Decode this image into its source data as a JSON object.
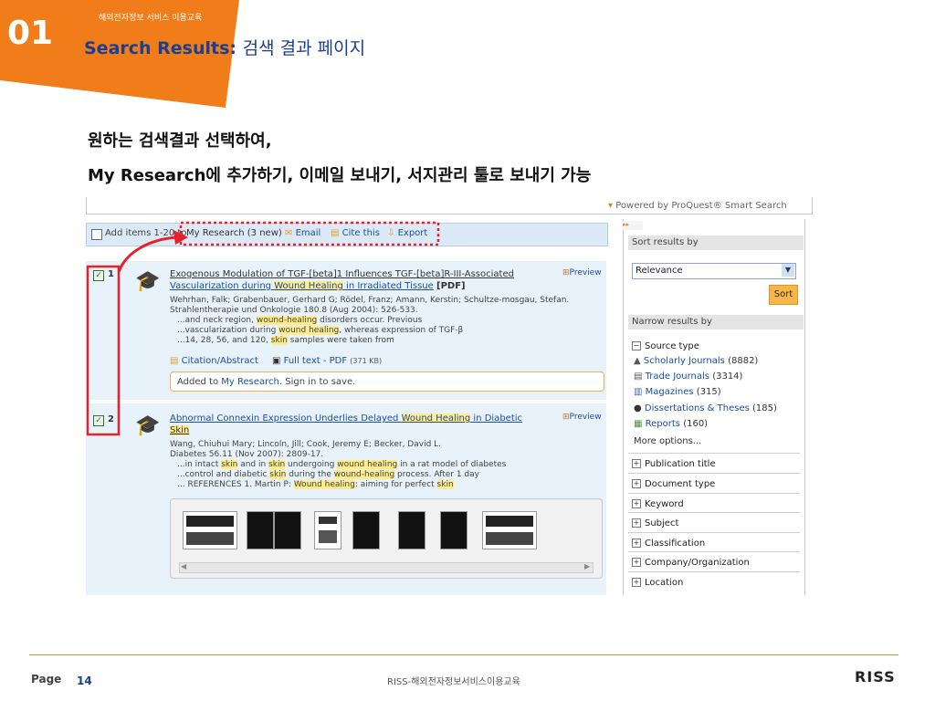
{
  "header": {
    "slide_number": "01",
    "caption": "해외전자정보 서비스 이용교육",
    "title_en": "Search Results:",
    "title_ko": "검색 결과 페이지"
  },
  "body_lines": [
    "원하는 검색결과 선택하여,",
    "My Research에 추가하기, 이메일 보내기, 서지관리 툴로 보내기 가능"
  ],
  "screenshot": {
    "powered_by": "Powered by ProQuest® Smart Search",
    "toolbar": {
      "add_items": "Add items 1-20 to",
      "my_research": "My Research (3 new)",
      "email": "Email",
      "cite": "Cite this",
      "export": "Export"
    },
    "results": [
      {
        "number": "1",
        "title_line1": "Exogenous Modulation of TGF-[beta]1 Influences TGF-[beta]R-III-Associated",
        "title_line2_pre": "Vascularization during ",
        "title_line2_hl": "Wound Healing",
        "title_line2_post": " in Irradiated Tissue",
        "format": "[PDF]",
        "preview": "Preview",
        "authors": "Wehrhan, Falk; Grabenbauer, Gerhard G; Rödel, Franz; Amann, Kerstin; Schultze-mosgau, Stefan.",
        "source": "Strahlentherapie und Onkologie 180.8 (Aug 2004): 526-533.",
        "snippets": [
          [
            "...and neck region, ",
            "wound-healing",
            " disorders occur. Previous"
          ],
          [
            "...vascularization during ",
            "wound healing",
            ", whereas expression of TGF-β"
          ],
          [
            "...14, 28, 56, and 120, ",
            "skin",
            " samples were taken from"
          ]
        ],
        "citation_link": "Citation/Abstract",
        "fulltext_link": "Full text - PDF",
        "fulltext_size": "(371 KB)",
        "added_pre": "Added to ",
        "added_link": "My Research",
        "added_post": ". Sign in to save."
      },
      {
        "number": "2",
        "title_pre": "Abnormal Connexin Expression Underlies Delayed ",
        "title_hl": "Wound Healing",
        "title_post": " in Diabetic",
        "title_line2_hl": "Skin",
        "preview": "Preview",
        "authors": "Wang, Chiuhui Mary; Lincoln, Jill; Cook, Jeremy E; Becker, David L.",
        "source": "Diabetes 56.11 (Nov 2007): 2809-17.",
        "snippets": [
          [
            "...in intact ",
            "skin",
            " and in ",
            "skin",
            " undergoing ",
            "wound healing",
            " in a rat model of diabetes"
          ],
          [
            "...control and diabetic ",
            "skin",
            " during the ",
            "wound-healing",
            " process. After 1 day"
          ],
          [
            "... REFERENCES 1. Martin P: ",
            "Wound healing",
            ": aiming for perfect ",
            "skin",
            ""
          ]
        ]
      }
    ],
    "sidebar": {
      "sort_heading": "Sort results by",
      "sort_value": "Relevance",
      "sort_button": "Sort",
      "narrow_heading": "Narrow results by",
      "source_type_label": "Source type",
      "source_types": [
        {
          "label": "Scholarly Journals",
          "count": "(8882)"
        },
        {
          "label": "Trade Journals",
          "count": "(3314)"
        },
        {
          "label": "Magazines",
          "count": "(315)"
        },
        {
          "label": "Dissertations & Theses",
          "count": "(185)"
        },
        {
          "label": "Reports",
          "count": "(160)"
        }
      ],
      "more_options": "More options...",
      "facets": [
        "Publication title",
        "Document type",
        "Keyword",
        "Subject",
        "Classification",
        "Company/Organization",
        "Location"
      ]
    }
  },
  "footer": {
    "page_label": "Page",
    "page_number": "14",
    "text": "RISS-해외전자정보서비스이용교육",
    "logo": "RISS"
  },
  "colors": {
    "accent_orange": "#f07d1a",
    "title_blue": "#1a3f8f",
    "highlight": "#ffec8c",
    "annotation_red": "#e8202a"
  }
}
